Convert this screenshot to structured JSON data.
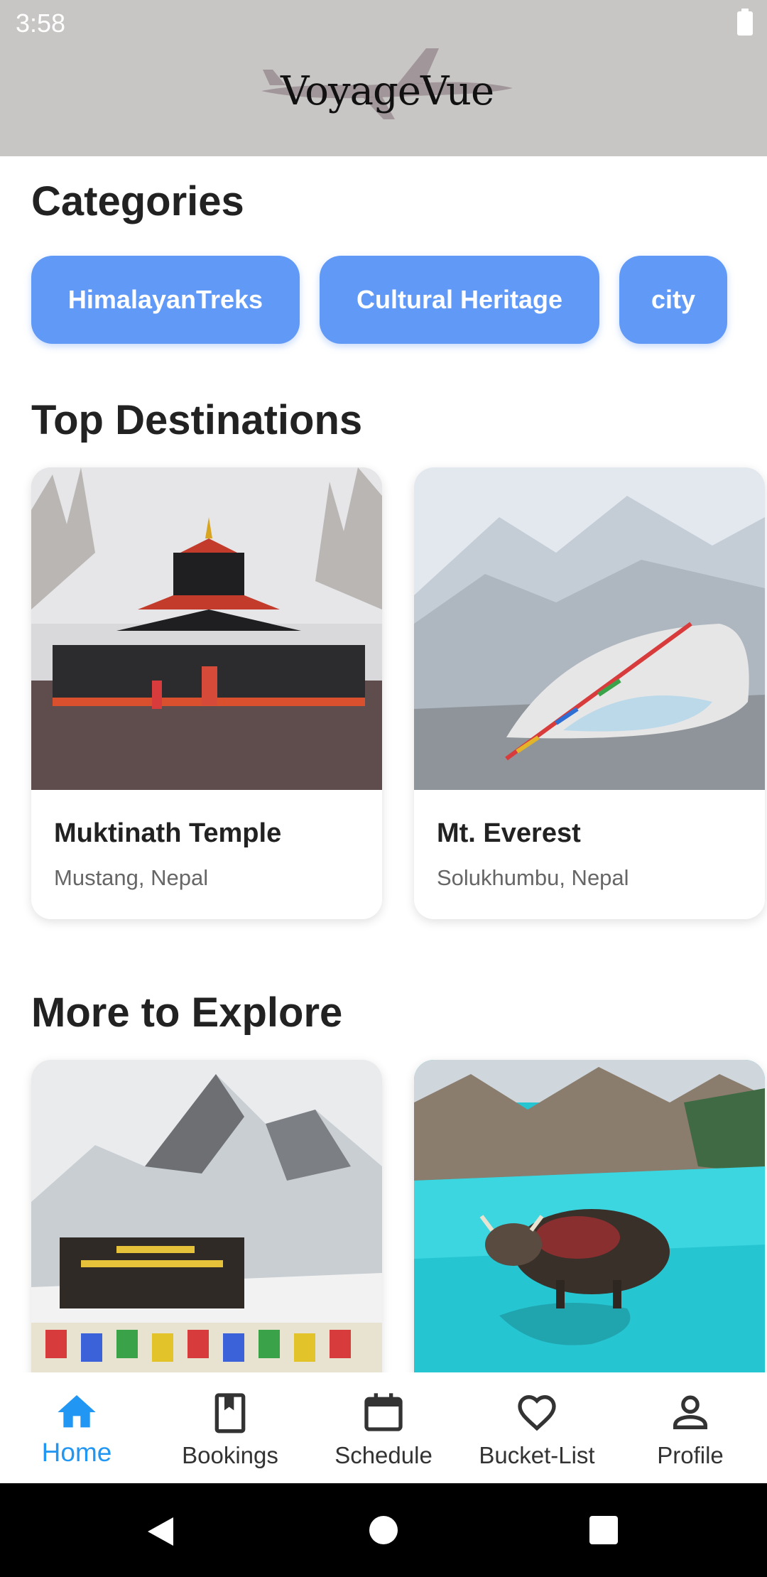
{
  "status": {
    "time": "3:58"
  },
  "header": {
    "app_name": "VoyageVue"
  },
  "categories": {
    "title": "Categories",
    "items": [
      "HimalayanTreks",
      "Cultural Heritage",
      "city"
    ],
    "chip_color": "#6199f7"
  },
  "top_destinations": {
    "title": "Top Destinations",
    "cards": [
      {
        "name": "Muktinath Temple",
        "location": "Mustang, Nepal"
      },
      {
        "name": "Mt. Everest",
        "location": "Solukhumbu, Nepal"
      }
    ]
  },
  "more_to_explore": {
    "title": "More to Explore",
    "cards": [
      {
        "image": "annapurna-base-camp-photo"
      },
      {
        "image": "lake-yak-photo"
      }
    ]
  },
  "bottom_nav": {
    "items": [
      {
        "label": "Home",
        "icon": "home-icon",
        "active": true
      },
      {
        "label": "Bookings",
        "icon": "bookmark-icon",
        "active": false
      },
      {
        "label": "Schedule",
        "icon": "calendar-icon",
        "active": false
      },
      {
        "label": "Bucket-List",
        "icon": "heart-icon",
        "active": false
      },
      {
        "label": "Profile",
        "icon": "person-icon",
        "active": false
      }
    ],
    "active_color": "#2196f3"
  }
}
